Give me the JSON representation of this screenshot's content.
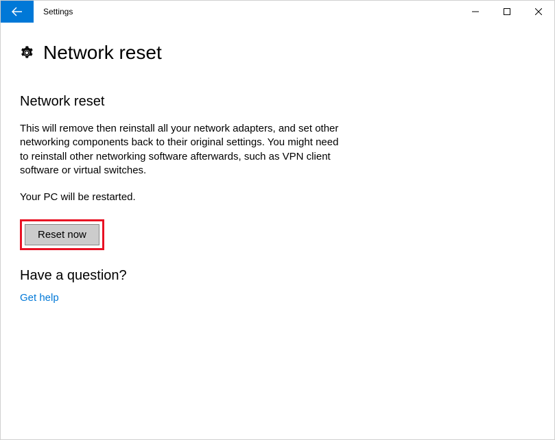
{
  "titlebar": {
    "app_name": "Settings"
  },
  "page": {
    "title": "Network reset",
    "section_heading": "Network reset",
    "description": "This will remove then reinstall all your network adapters, and set other networking components back to their original settings. You might need to reinstall other networking software afterwards, such as VPN client software or virtual switches.",
    "restart_notice": "Your PC will be restarted.",
    "reset_button_label": "Reset now",
    "question_heading": "Have a question?",
    "help_link_label": "Get help"
  },
  "colors": {
    "accent": "#0078d7",
    "highlight_border": "#e81123"
  }
}
